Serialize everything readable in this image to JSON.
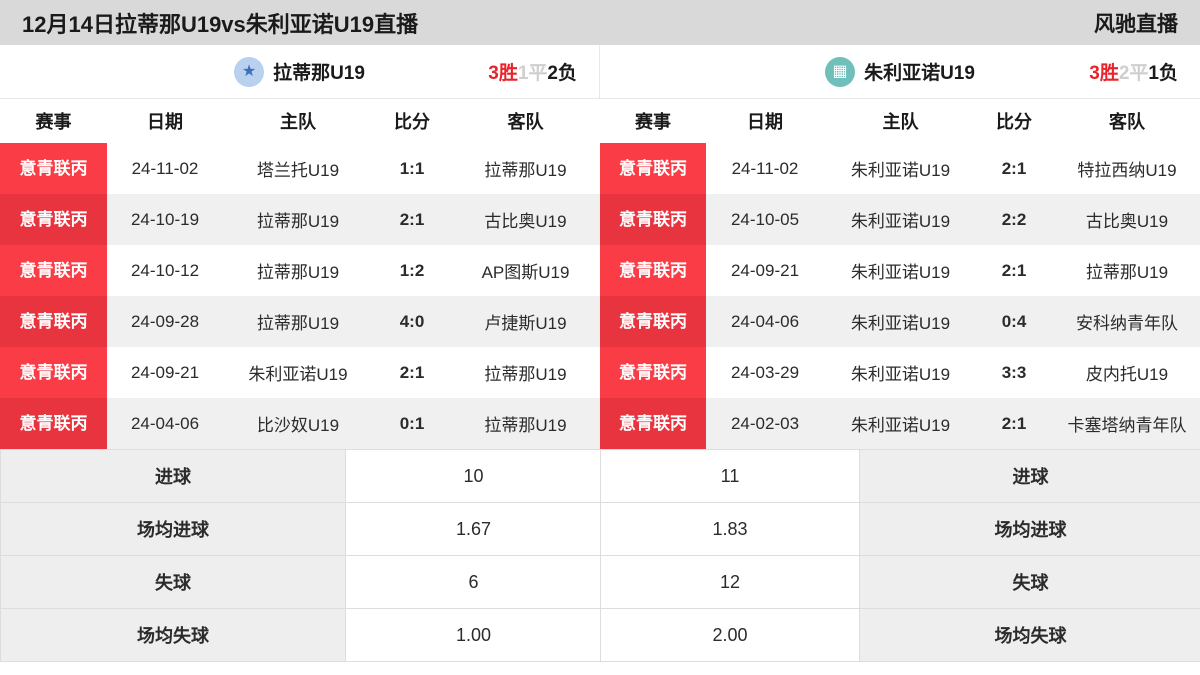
{
  "topbar": {
    "title": "12月14日拉蒂那U19vs朱利亚诺U19直播",
    "brand": "风驰直播"
  },
  "teams": {
    "home": {
      "name": "拉蒂那U19",
      "logo_icon": "team-crest-icon",
      "logo_color": "#b9d1ee",
      "record": {
        "win": "3胜",
        "draw": "1平",
        "loss": "2负"
      }
    },
    "away": {
      "name": "朱利亚诺U19",
      "logo_icon": "team-goal-icon",
      "logo_color": "#6fbfbb",
      "record": {
        "win": "3胜",
        "draw": "2平",
        "loss": "1负"
      }
    }
  },
  "colors": {
    "league_badge": "#fa3c46",
    "league_badge_alt": "#e8343e",
    "win": "#e8232a",
    "draw": "#cfcfcf",
    "loss": "#1a1a1a",
    "topbar_bg": "#d9d9d9"
  },
  "match_table": {
    "headers": [
      "赛事",
      "日期",
      "主队",
      "比分",
      "客队"
    ],
    "home_rows": [
      {
        "league": "意青联丙",
        "date": "24-11-02",
        "home": "塔兰托U19",
        "score": "1:1",
        "away": "拉蒂那U19"
      },
      {
        "league": "意青联丙",
        "date": "24-10-19",
        "home": "拉蒂那U19",
        "score": "2:1",
        "away": "古比奥U19"
      },
      {
        "league": "意青联丙",
        "date": "24-10-12",
        "home": "拉蒂那U19",
        "score": "1:2",
        "away": "AP图斯U19"
      },
      {
        "league": "意青联丙",
        "date": "24-09-28",
        "home": "拉蒂那U19",
        "score": "4:0",
        "away": "卢捷斯U19"
      },
      {
        "league": "意青联丙",
        "date": "24-09-21",
        "home": "朱利亚诺U19",
        "score": "2:1",
        "away": "拉蒂那U19"
      },
      {
        "league": "意青联丙",
        "date": "24-04-06",
        "home": "比沙奴U19",
        "score": "0:1",
        "away": "拉蒂那U19"
      }
    ],
    "away_rows": [
      {
        "league": "意青联丙",
        "date": "24-11-02",
        "home": "朱利亚诺U19",
        "score": "2:1",
        "away": "特拉西纳U19"
      },
      {
        "league": "意青联丙",
        "date": "24-10-05",
        "home": "朱利亚诺U19",
        "score": "2:2",
        "away": "古比奥U19"
      },
      {
        "league": "意青联丙",
        "date": "24-09-21",
        "home": "朱利亚诺U19",
        "score": "2:1",
        "away": "拉蒂那U19"
      },
      {
        "league": "意青联丙",
        "date": "24-04-06",
        "home": "朱利亚诺U19",
        "score": "0:4",
        "away": "安科纳青年队"
      },
      {
        "league": "意青联丙",
        "date": "24-03-29",
        "home": "朱利亚诺U19",
        "score": "3:3",
        "away": "皮内托U19"
      },
      {
        "league": "意青联丙",
        "date": "24-02-03",
        "home": "朱利亚诺U19",
        "score": "2:1",
        "away": "卡塞塔纳青年队"
      }
    ]
  },
  "stats": {
    "rows": [
      {
        "label": "进球",
        "home_value": "10",
        "away_value": "11"
      },
      {
        "label": "场均进球",
        "home_value": "1.67",
        "away_value": "1.83"
      },
      {
        "label": "失球",
        "home_value": "6",
        "away_value": "12"
      },
      {
        "label": "场均失球",
        "home_value": "1.00",
        "away_value": "2.00"
      }
    ]
  }
}
